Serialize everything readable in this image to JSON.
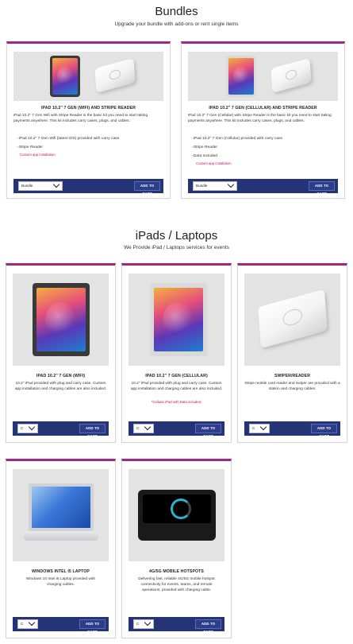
{
  "bundles": {
    "title": "Bundles",
    "subtitle": "Upgrade your bundle with add-ons or rent single items",
    "cards": [
      {
        "title": "IPAD 10.2\" 7 GEN (WIFI) AND STRIPE READER",
        "desc": "iPad 10.2\" 7 Gen Wifi with Stripe Reader is the basic kit you need to start taking payments anywhere. This kit includes carry cases, plugs, and cables.",
        "items": [
          "iPad 10.2\" 7 Gen Wifi (latest iOS) provided with carry case",
          "Stripe Reader"
        ],
        "note": "Custom app installation",
        "select": "Bundle",
        "button": "ADD TO CART"
      },
      {
        "title": "IPAD 10.2\" 7 GEN (CELLULAR) AND STRIPE READER",
        "desc": "iPad 10.2\" 7 Gen (Cellular) with Stripe Reader is the basic kit you need to start taking payments anywhere. This kit includes carry cases, plugs, and cables.",
        "items": [
          "iPad 10.2\" 7 Gen (Cellular) provided with carry case",
          "Stripe Reader",
          "Data Included"
        ],
        "note": "Custom app installation",
        "select": "Bundle",
        "button": "ADD TO CART"
      }
    ]
  },
  "ipads": {
    "title": "iPads / Laptops",
    "subtitle": "We Provide iPad / Laptops services for events",
    "cards": [
      {
        "title": "IPAD 10.2\" 7 GEN (WIFI)",
        "desc": "10.2\" iPad provided with plug and carry case. Custom app installation and charging cables are also included.",
        "note": "",
        "select": "C",
        "button": "ADD TO CART"
      },
      {
        "title": "IPAD 10.2\" 7 GEN (CELLULAR)",
        "desc": "10.2\" iPad provided with plug and carry case. Custom app installation and charging cables are also included.",
        "note": "*Cellular iPad with Data included.",
        "select": "C",
        "button": "ADD TO CART"
      },
      {
        "title": "SWIPER/READER",
        "desc": "Stripe mobile card reader and swiper are provided with a station and charging cables.",
        "note": "",
        "select": "C",
        "button": "ADD TO CART"
      },
      {
        "title": "WINDOWS INTEL I5 LAPTOP",
        "desc": "Windows 10 Intel i5 Laptop provided with charging cables.",
        "note": "",
        "select": "C",
        "button": "ADD TO CART"
      },
      {
        "title": "4G/5G MOBILE HOTSPOTS",
        "desc": "Delivering fast, reliable 4G/5G mobile hotspot connectivity for events, teams, and remote operations; provided with charging cable.",
        "note": "",
        "select": "C",
        "button": "ADD TO CART"
      }
    ]
  },
  "colors": {
    "accent": "#9c2a84",
    "bar": "#243477",
    "button": "#2c3e8a",
    "note": "#c2185b"
  }
}
